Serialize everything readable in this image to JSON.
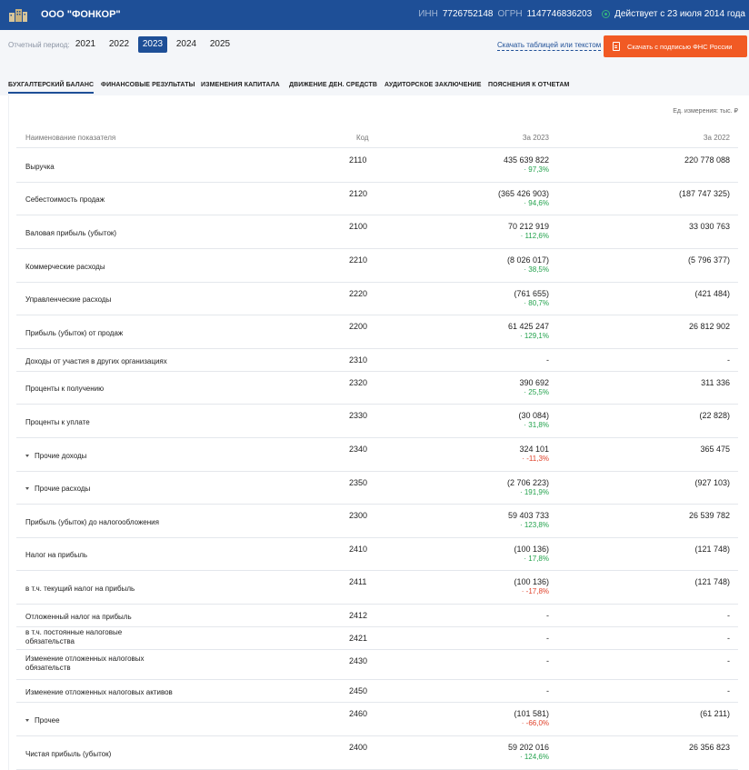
{
  "header": {
    "company": "ООО \"ФОНКОР\"",
    "inn_label": "ИНН",
    "inn": "7726752148",
    "ogrn_label": "ОГРН",
    "ogrn": "1147746836203",
    "status": "Действует с 23 июля 2014 года"
  },
  "period": {
    "label": "Отчетный период:",
    "years": [
      "2021",
      "2022",
      "2023",
      "2024",
      "2025"
    ],
    "active": "2023",
    "download_text": "Скачать таблицей или текстом",
    "download_signed": "Скачать с подписью ФНС России"
  },
  "tabs": [
    "БУХГАЛТЕРСКИЙ БАЛАНС",
    "ФИНАНСОВЫЕ РЕЗУЛЬТАТЫ",
    "ИЗМЕНЕНИЯ КАПИТАЛА",
    "ДВИЖЕНИЕ ДЕН. СРЕДСТВ",
    "АУДИТОРСКОЕ ЗАКЛЮЧЕНИЕ",
    "ПОЯСНЕНИЯ К ОТЧЕТАМ"
  ],
  "table": {
    "units": "Ед. измерения: тыс. ₽",
    "col_name": "Наименование показателя",
    "col_code": "Код",
    "col_y1": "За 2023",
    "col_y2": "За 2022",
    "rows": [
      {
        "name": "Выручка",
        "code": "2110",
        "v1": "435 639 822",
        "pct": "· 97,3%",
        "dir": "up",
        "v2": "220 778 088"
      },
      {
        "name": "Себестоимость продаж",
        "code": "2120",
        "v1": "(365 426 903)",
        "pct": "· 94,6%",
        "dir": "up",
        "v2": "(187 747 325)"
      },
      {
        "name": "Валовая прибыль (убыток)",
        "code": "2100",
        "v1": "70 212 919",
        "pct": "· 112,6%",
        "dir": "up",
        "v2": "33 030 763"
      },
      {
        "name": "Коммерческие расходы",
        "code": "2210",
        "v1": "(8 026 017)",
        "pct": "· 38,5%",
        "dir": "up",
        "v2": "(5 796 377)"
      },
      {
        "name": "Управленческие расходы",
        "code": "2220",
        "v1": "(761 655)",
        "pct": "· 80,7%",
        "dir": "up",
        "v2": "(421 484)"
      },
      {
        "name": "Прибыль (убыток) от продаж",
        "code": "2200",
        "v1": "61 425 247",
        "pct": "· 129,1%",
        "dir": "up",
        "v2": "26 812 902"
      },
      {
        "name": "Доходы от участия в других организациях",
        "code": "2310",
        "v1": "-",
        "pct": "",
        "dir": "",
        "v2": "-"
      },
      {
        "name": "Проценты к получению",
        "code": "2320",
        "v1": "390 692",
        "pct": "· 25,5%",
        "dir": "up",
        "v2": "311 336"
      },
      {
        "name": "Проценты к уплате",
        "code": "2330",
        "v1": "(30 084)",
        "pct": "· 31,8%",
        "dir": "up",
        "v2": "(22 828)"
      },
      {
        "name": "Прочие доходы",
        "code": "2340",
        "v1": "324 101",
        "pct": "· -11,3%",
        "dir": "down",
        "v2": "365 475",
        "expand": true
      },
      {
        "name": "Прочие расходы",
        "code": "2350",
        "v1": "(2 706 223)",
        "pct": "· 191,9%",
        "dir": "up",
        "v2": "(927 103)",
        "expand": true
      },
      {
        "name": "Прибыль (убыток) до налогообложения",
        "code": "2300",
        "v1": "59 403 733",
        "pct": "· 123,8%",
        "dir": "up",
        "v2": "26 539 782"
      },
      {
        "name": "Налог на прибыль",
        "code": "2410",
        "v1": "(100 136)",
        "pct": "· 17,8%",
        "dir": "up",
        "v2": "(121 748)"
      },
      {
        "name": "в т.ч. текущий налог на прибыль",
        "code": "2411",
        "v1": "(100 136)",
        "pct": "· -17,8%",
        "dir": "down",
        "v2": "(121 748)"
      },
      {
        "name": "Отложенный налог на прибыль",
        "code": "2412",
        "v1": "-",
        "pct": "",
        "dir": "",
        "v2": "-"
      },
      {
        "name": "в т.ч. постоянные налоговые обязательства",
        "code": "2421",
        "v1": "-",
        "pct": "",
        "dir": "",
        "v2": "-"
      },
      {
        "name": "Изменение отложенных налоговых обязательств",
        "code": "2430",
        "v1": "-",
        "pct": "",
        "dir": "",
        "v2": "-"
      },
      {
        "name": "Изменение отложенных налоговых активов",
        "code": "2450",
        "v1": "-",
        "pct": "",
        "dir": "",
        "v2": "-"
      },
      {
        "name": "Прочее",
        "code": "2460",
        "v1": "(101 581)",
        "pct": "· -66,0%",
        "dir": "down",
        "v2": "(61 211)",
        "expand": true
      },
      {
        "name": "Чистая прибыль (убыток)",
        "code": "2400",
        "v1": "59 202 016",
        "pct": "· 124,6%",
        "dir": "up",
        "v2": "26 356 823"
      }
    ]
  },
  "colors": {
    "brand_blue": "#1e4f97",
    "accent_orange": "#f15a24",
    "positive": "#23a24d",
    "negative": "#e0422b"
  }
}
